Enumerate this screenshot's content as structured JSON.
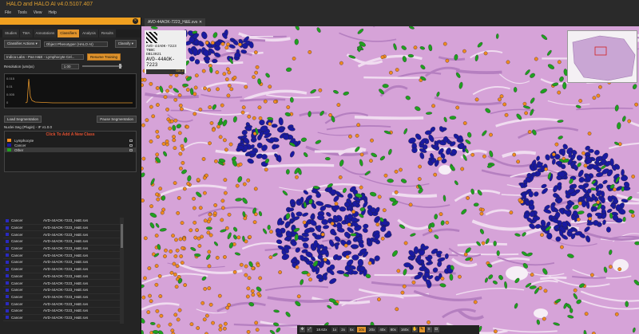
{
  "window": {
    "title": "HALO and HALO AI v4.0.5107.407"
  },
  "menu": [
    "File",
    "Tools",
    "View",
    "Help"
  ],
  "tabs": [
    "Studies",
    "TMA",
    "Annotations",
    "Classifiers",
    "Analysis",
    "Results"
  ],
  "classifier": {
    "actions_label": "Classifier Actions",
    "phenotyper_label": "Object Phenotyper (HALO AI)",
    "classify_label": "Classify",
    "indica_label": "Indica Labs - Pan H&E - Lymphocyte Cel...",
    "resume_label": "Resume Training",
    "resolution_label": "Resolution (um/px)",
    "resolution_value": "1.00"
  },
  "graph": {
    "y_ticks": [
      "0.015",
      "0.01",
      "0.005",
      "0"
    ]
  },
  "buttons": {
    "load_seg": "Load Segmentation",
    "pause_seg": "Pause Segmentation"
  },
  "plugin_label": "Nuclei Seg (Plugin) - IF v1.0.0",
  "add_class_label": "Click To Add A New Class",
  "classes": [
    {
      "name": "Lymphocyte",
      "color": "#f08a20"
    },
    {
      "name": "Cancer",
      "color": "#1a1aa0"
    },
    {
      "name": "Other",
      "color": "#20a020"
    }
  ],
  "table_rows": [
    {
      "cls": "Cancer",
      "file": "AVD-44AOK-7223_H&E.svs"
    },
    {
      "cls": "Cancer",
      "file": "AVD-44AOK-7223_H&E.svs"
    },
    {
      "cls": "Cancer",
      "file": "AVD-44AOK-7223_H&E.svs"
    },
    {
      "cls": "Cancer",
      "file": "AVD-44AOK-7223_H&E.svs"
    },
    {
      "cls": "Cancer",
      "file": "AVD-44AOK-7223_H&E.svs"
    },
    {
      "cls": "Cancer",
      "file": "AVD-44AOK-7223_H&E.svs"
    },
    {
      "cls": "Cancer",
      "file": "AVD-44AOK-7223_H&E.svs"
    },
    {
      "cls": "Cancer",
      "file": "AVD-44AOK-7223_H&E.svs"
    },
    {
      "cls": "Cancer",
      "file": "AVD-44AOK-7223_H&E.svs"
    },
    {
      "cls": "Cancer",
      "file": "AVD-44AOK-7223_H&E.svs"
    },
    {
      "cls": "Cancer",
      "file": "AVD-44AOK-7223_H&E.svs"
    },
    {
      "cls": "Cancer",
      "file": "AVD-44AOK-7223_H&E.svs"
    },
    {
      "cls": "Cancer",
      "file": "AVD-44AOK-7223_H&E.svs"
    },
    {
      "cls": "Cancer",
      "file": "AVD-44AOK-7223_H&E.svs"
    },
    {
      "cls": "Cancer",
      "file": "AVD-44AOK-7223_H&E.svs"
    }
  ],
  "viewer": {
    "tab_label": "AVD-44AOK-7223_H&E.svs",
    "slide_label": {
      "line1": "AVD-44AOK-7223",
      "line2": "TNBC",
      "line3": "DB13021",
      "line4": "AVD-44AOK-7223",
      "gold": "GOLD"
    },
    "zoom": {
      "value": "18.62x",
      "levels": [
        "1x",
        "2x",
        "5x",
        "10x",
        "20x",
        "40x",
        "80x",
        "160x"
      ],
      "active": "10x"
    }
  },
  "colors": {
    "accent": "#e0932b",
    "lymphocyte": "#f08a20",
    "cancer": "#1a1aa0",
    "other": "#20a020"
  }
}
